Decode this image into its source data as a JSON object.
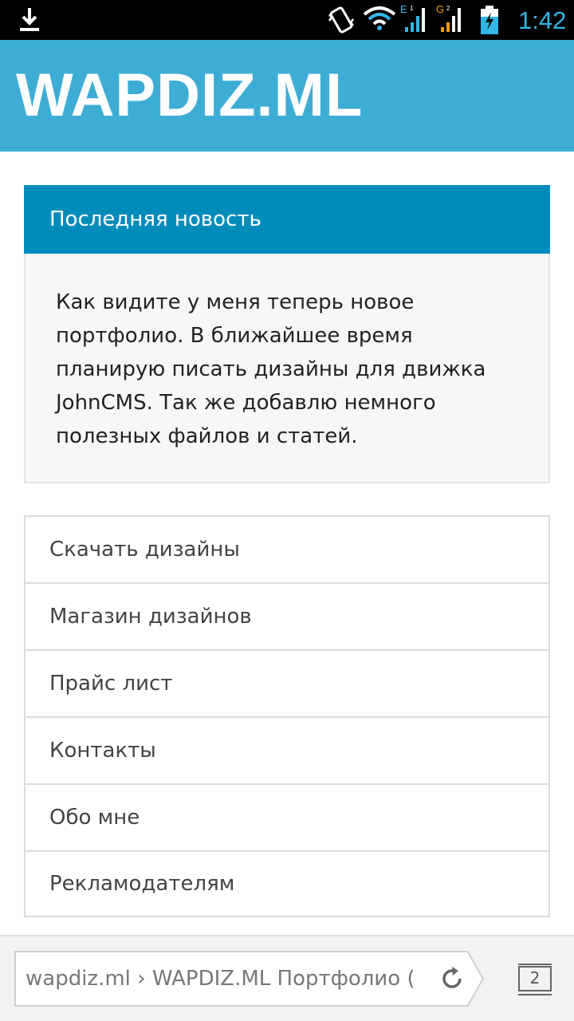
{
  "status_bar": {
    "time": "1:42",
    "network_1_label": "E",
    "network_2_label": "G",
    "sim_1": "1",
    "sim_2": "2",
    "icons": [
      "download-icon",
      "vibrate-icon",
      "wifi-icon",
      "signal-icon",
      "signal-icon",
      "battery-charging-icon"
    ],
    "time_color": "#33b5e5"
  },
  "header": {
    "site_title": "WAPDIZ.ML",
    "bg_color": "#3eadd6"
  },
  "news": {
    "title": "Последняя новость",
    "body": "Как видите у меня теперь новое портфолио. В ближайшее время планирую писать дизайны для движка JohnCMS. Так же добавлю немного полезных файлов и статей.",
    "header_color": "#008cba"
  },
  "menu": {
    "items": [
      "Скачать дизайны",
      "Магазин дизайнов",
      "Прайс лист",
      "Контакты",
      "Обо мне",
      "Рекламодателям"
    ]
  },
  "browser": {
    "url_text": "wapdiz.ml › WAPDIZ.ML Портфолио (",
    "tab_count": "2",
    "icons": [
      "reload-icon",
      "tabs-icon"
    ]
  }
}
